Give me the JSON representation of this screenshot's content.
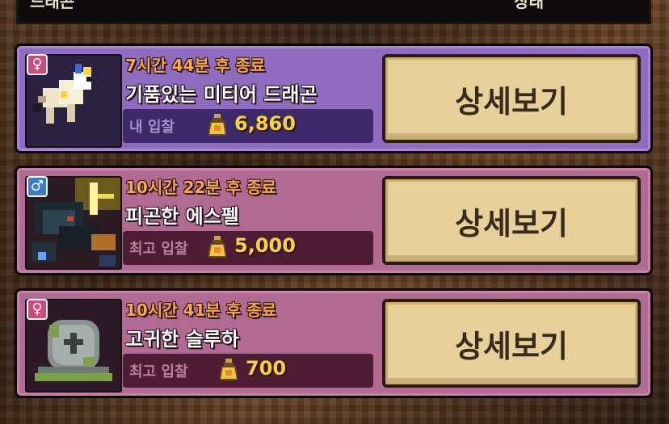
{
  "header": {
    "left_label": "드래곤",
    "right_label": "상태"
  },
  "auctions": [
    {
      "time_left": "7시간 44분 후 종료",
      "name": "기품있는 미티어 드래곤",
      "bid_label": "내 입찰",
      "bid_amount": "6,860",
      "gender": "female",
      "gender_symbol": "♀",
      "detail_button": "상세보기"
    },
    {
      "time_left": "10시간 22분 후 종료",
      "name": "피곤한 에스펠",
      "bid_label": "최고 입찰",
      "bid_amount": "5,000",
      "gender": "male",
      "gender_symbol": "♂",
      "detail_button": "상세보기"
    },
    {
      "time_left": "10시간 41분 후 종료",
      "name": "고귀한 슬루하",
      "bid_label": "최고 입찰",
      "bid_amount": "700",
      "gender": "female",
      "gender_symbol": "♀",
      "detail_button": "상세보기"
    }
  ],
  "colors": {
    "row_purple": "#8f6cc0",
    "row_pink": "#b16a92",
    "time_text": "#f4a94a",
    "bid_value": "#f7d23a",
    "button_bg": "#e7d09a"
  }
}
